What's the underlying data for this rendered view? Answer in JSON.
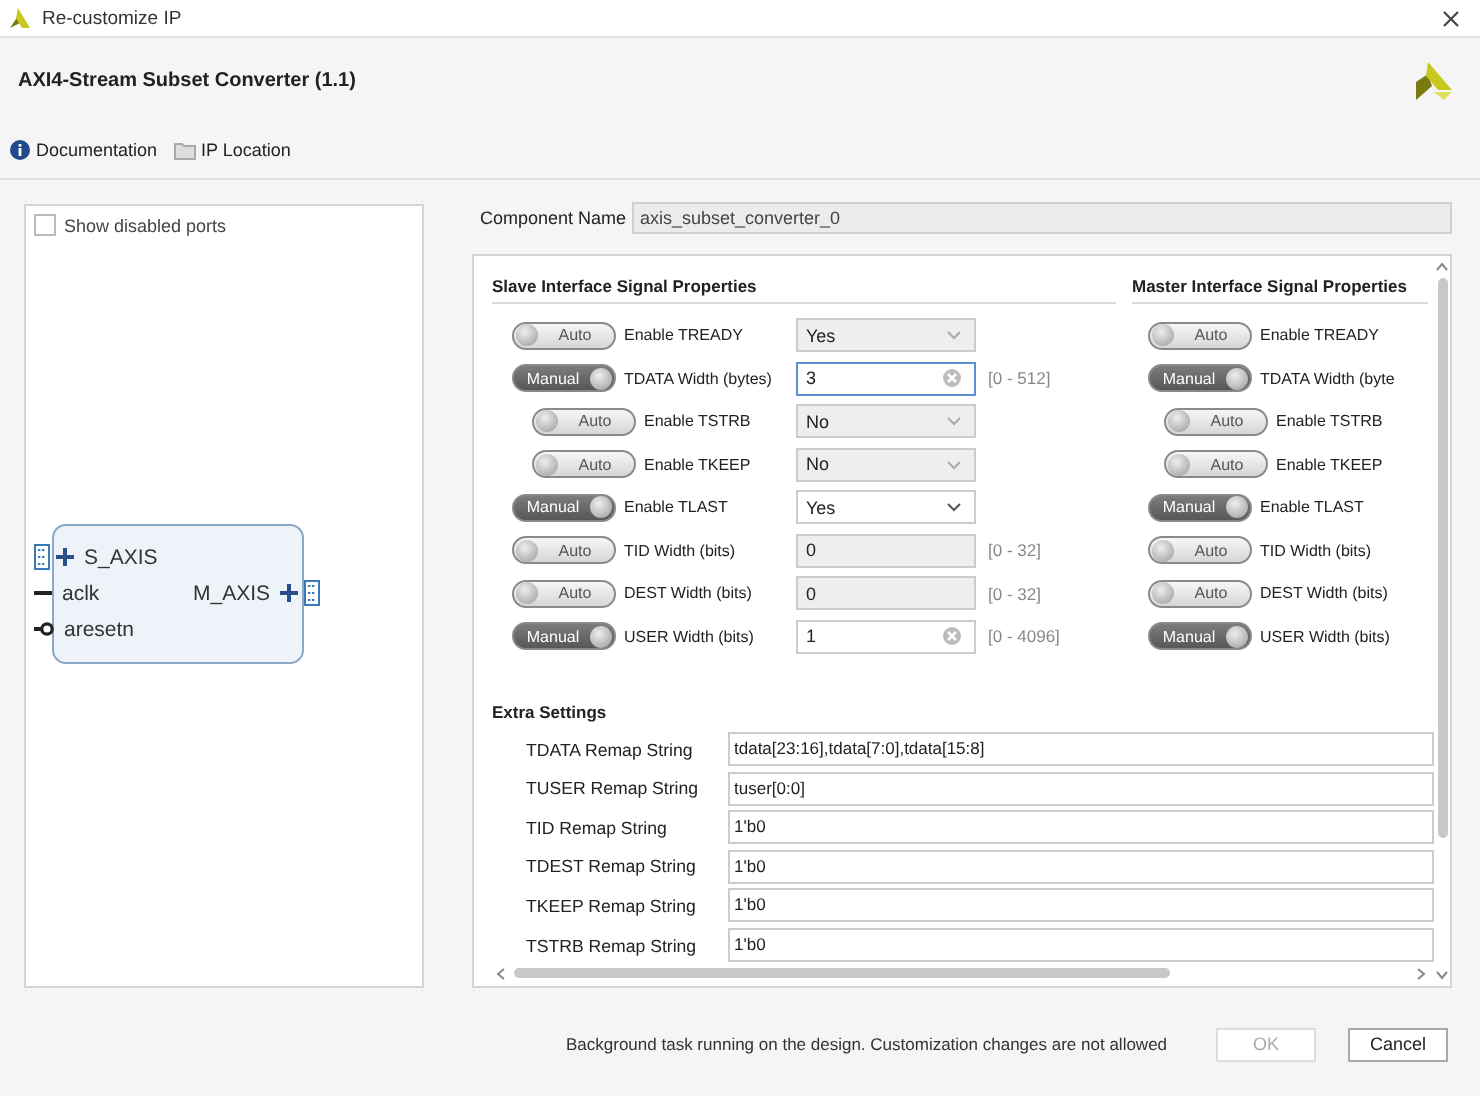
{
  "window": {
    "title": "Re-customize IP"
  },
  "header": {
    "title": "AXI4-Stream Subset Converter (1.1)"
  },
  "links": [
    {
      "kind": "info",
      "label": "Documentation"
    },
    {
      "kind": "folder",
      "label": "IP Location"
    }
  ],
  "symbol_panel": {
    "show_disabled_ports": {
      "label": "Show disabled ports",
      "checked": false
    },
    "left_ports": [
      {
        "kind": "bus",
        "name": "S_AXIS"
      },
      {
        "kind": "clock",
        "name": "aclk"
      },
      {
        "kind": "reset",
        "name": "aresetn"
      }
    ],
    "right_ports": [
      {
        "kind": "bus",
        "name": "M_AXIS"
      }
    ]
  },
  "component_name": {
    "label": "Component Name",
    "value": "axis_subset_converter_0"
  },
  "slave": {
    "title": "Slave Interface Signal Properties",
    "rows": [
      {
        "mode": "Auto",
        "manual": false,
        "indented": false,
        "label": "Enable TREADY",
        "field": {
          "kind": "dropdown",
          "value": "Yes",
          "disabled": true,
          "focused": false
        }
      },
      {
        "mode": "Manual",
        "manual": true,
        "indented": false,
        "label": "TDATA Width (bytes)",
        "field": {
          "kind": "text",
          "value": "3",
          "disabled": false,
          "focused": true,
          "range": "[0 - 512]"
        }
      },
      {
        "mode": "Auto",
        "manual": false,
        "indented": true,
        "label": "Enable TSTRB",
        "field": {
          "kind": "dropdown",
          "value": "No",
          "disabled": true,
          "focused": false
        }
      },
      {
        "mode": "Auto",
        "manual": false,
        "indented": true,
        "label": "Enable TKEEP",
        "field": {
          "kind": "dropdown",
          "value": "No",
          "disabled": true,
          "focused": false
        }
      },
      {
        "mode": "Manual",
        "manual": true,
        "indented": false,
        "label": "Enable TLAST",
        "field": {
          "kind": "dropdown",
          "value": "Yes",
          "disabled": false,
          "focused": false
        }
      },
      {
        "mode": "Auto",
        "manual": false,
        "indented": false,
        "label": "TID Width (bits)",
        "field": {
          "kind": "text",
          "value": "0",
          "disabled": true,
          "focused": false,
          "range": "[0 - 32]"
        }
      },
      {
        "mode": "Auto",
        "manual": false,
        "indented": false,
        "label": "DEST Width (bits)",
        "field": {
          "kind": "text",
          "value": "0",
          "disabled": true,
          "focused": false,
          "range": "[0 - 32]"
        }
      },
      {
        "mode": "Manual",
        "manual": true,
        "indented": false,
        "label": "USER Width (bits)",
        "field": {
          "kind": "text",
          "value": "1",
          "disabled": false,
          "focused": false,
          "range": "[0 - 4096]"
        }
      }
    ]
  },
  "master": {
    "title": "Master Interface Signal Properties",
    "rows": [
      {
        "mode": "Auto",
        "manual": false,
        "indented": false,
        "label": "Enable TREADY"
      },
      {
        "mode": "Manual",
        "manual": true,
        "indented": false,
        "label": "TDATA Width (byte"
      },
      {
        "mode": "Auto",
        "manual": false,
        "indented": true,
        "label": "Enable TSTRB"
      },
      {
        "mode": "Auto",
        "manual": false,
        "indented": true,
        "label": "Enable TKEEP"
      },
      {
        "mode": "Manual",
        "manual": true,
        "indented": false,
        "label": "Enable TLAST"
      },
      {
        "mode": "Auto",
        "manual": false,
        "indented": false,
        "label": "TID Width (bits)"
      },
      {
        "mode": "Auto",
        "manual": false,
        "indented": false,
        "label": "DEST Width (bits)"
      },
      {
        "mode": "Manual",
        "manual": true,
        "indented": false,
        "label": "USER Width (bits)"
      }
    ]
  },
  "extra": {
    "title": "Extra Settings",
    "rows": [
      {
        "label": "TDATA Remap String",
        "value": "tdata[23:16],tdata[7:0],tdata[15:8]"
      },
      {
        "label": "TUSER Remap String",
        "value": "tuser[0:0]"
      },
      {
        "label": "TID Remap String",
        "value": "1'b0"
      },
      {
        "label": "TDEST Remap String",
        "value": "1'b0"
      },
      {
        "label": "TKEEP Remap String",
        "value": "1'b0"
      },
      {
        "label": "TSTRB Remap String",
        "value": "1'b0"
      }
    ]
  },
  "footer": {
    "status": "Background task running on the design. Customization changes are not allowed",
    "buttons": [
      {
        "label": "OK",
        "disabled": true
      },
      {
        "label": "Cancel",
        "disabled": false
      }
    ]
  }
}
